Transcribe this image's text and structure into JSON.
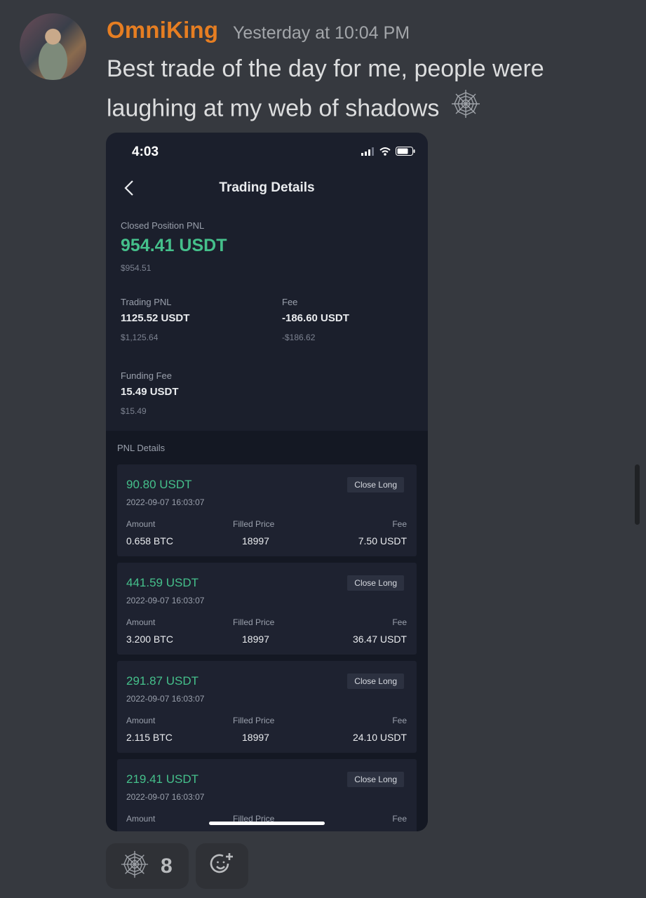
{
  "message": {
    "username": "OmniKing",
    "timestamp": "Yesterday at 10:04 PM",
    "text": "Best trade of the day for me, people were laughing at my web of shadows",
    "emoji_icon": "spider-web-icon"
  },
  "phone": {
    "status_time": "4:03",
    "nav_title": "Trading Details",
    "summary": {
      "closed_label": "Closed Position PNL",
      "closed_value": "954.41 USDT",
      "closed_usd": "$954.51",
      "trading_label": "Trading PNL",
      "trading_value": "1125.52 USDT",
      "trading_usd": "$1,125.64",
      "fee_label": "Fee",
      "fee_value": "-186.60 USDT",
      "fee_usd": "-$186.62",
      "funding_label": "Funding Fee",
      "funding_value": "15.49 USDT",
      "funding_usd": "$15.49"
    },
    "details_label": "PNL Details",
    "cards": [
      {
        "pnl": "90.80 USDT",
        "date": "2022-09-07 16:03:07",
        "badge": "Close Long",
        "amount_label": "Amount",
        "price_label": "Filled Price",
        "fee_label": "Fee",
        "amount": "0.658 BTC",
        "price": "18997",
        "fee": "7.50 USDT"
      },
      {
        "pnl": "441.59 USDT",
        "date": "2022-09-07 16:03:07",
        "badge": "Close Long",
        "amount_label": "Amount",
        "price_label": "Filled Price",
        "fee_label": "Fee",
        "amount": "3.200 BTC",
        "price": "18997",
        "fee": "36.47 USDT"
      },
      {
        "pnl": "291.87 USDT",
        "date": "2022-09-07 16:03:07",
        "badge": "Close Long",
        "amount_label": "Amount",
        "price_label": "Filled Price",
        "fee_label": "Fee",
        "amount": "2.115 BTC",
        "price": "18997",
        "fee": "24.10 USDT"
      },
      {
        "pnl": "219.41 USDT",
        "date": "2022-09-07 16:03:07",
        "badge": "Close Long",
        "amount_label": "Amount",
        "price_label": "Filled Price",
        "fee_label": "Fee",
        "amount": "",
        "price": "",
        "fee": ""
      }
    ]
  },
  "reactions": {
    "web_count": "8",
    "web_icon": "spider-web-icon",
    "add_icon": "add-reaction-icon"
  },
  "colors": {
    "username": "#e67e22",
    "profit_green": "#45c08b",
    "background": "#36393f"
  }
}
